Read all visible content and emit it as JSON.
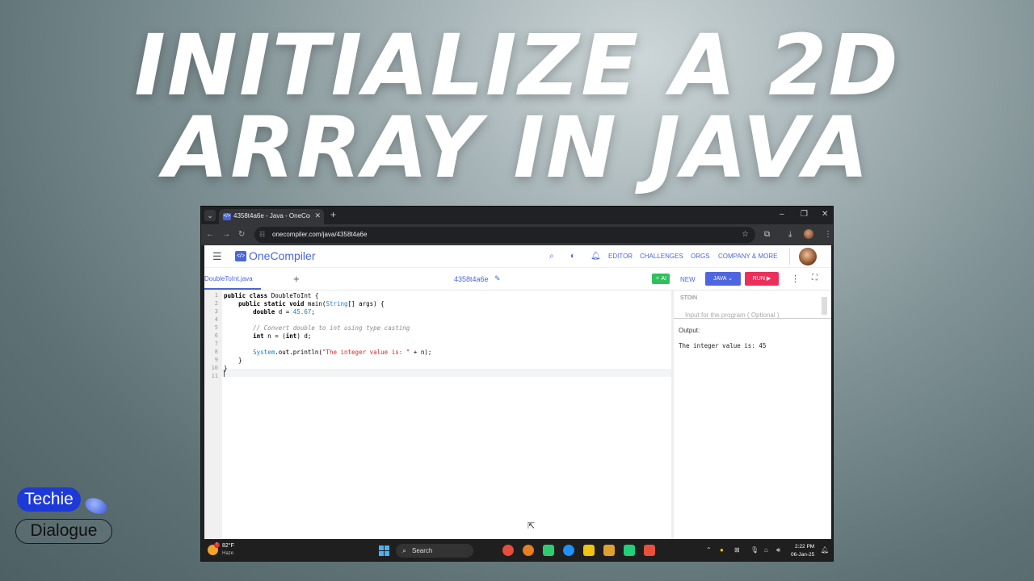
{
  "headline": {
    "line1": "INITIALIZE A 2D",
    "line2": "ARRAY IN JAVA"
  },
  "browser": {
    "tab_title": "4358t4a6e - Java - OneCompiler",
    "url": "onecompiler.com/java/4358t4a6e"
  },
  "app": {
    "logo": "OneCompiler",
    "nav": [
      "EDITOR",
      "CHALLENGES",
      "ORGS",
      "COMPANY & MORE"
    ],
    "file_tab": "DoubleToInt.java",
    "code_id": "4358t4a6e",
    "ai_label": "AI",
    "new_label": "NEW",
    "lang_label": "JAVA",
    "run_label": "RUN"
  },
  "code": {
    "line_numbers": [
      "1",
      "2",
      "3",
      "4",
      "5",
      "6",
      "7",
      "8",
      "9",
      "10",
      "11"
    ]
  },
  "stdin": {
    "label": "STDIN",
    "placeholder": "Input for the program ( Optional )"
  },
  "output": {
    "label": "Output:",
    "text": "The integer value is: 45"
  },
  "taskbar": {
    "temp": "82°F",
    "weather": "Haze",
    "search": "Search",
    "time": "2:22 PM",
    "date": "06-Jan-25"
  },
  "brand": {
    "line1": "Techie",
    "line2": "Dialogue"
  },
  "colors": {
    "accent": "#4a67d8",
    "run": "#ec2f5a",
    "ai": "#2fbf5c",
    "brand_blue": "#1d39d8"
  }
}
